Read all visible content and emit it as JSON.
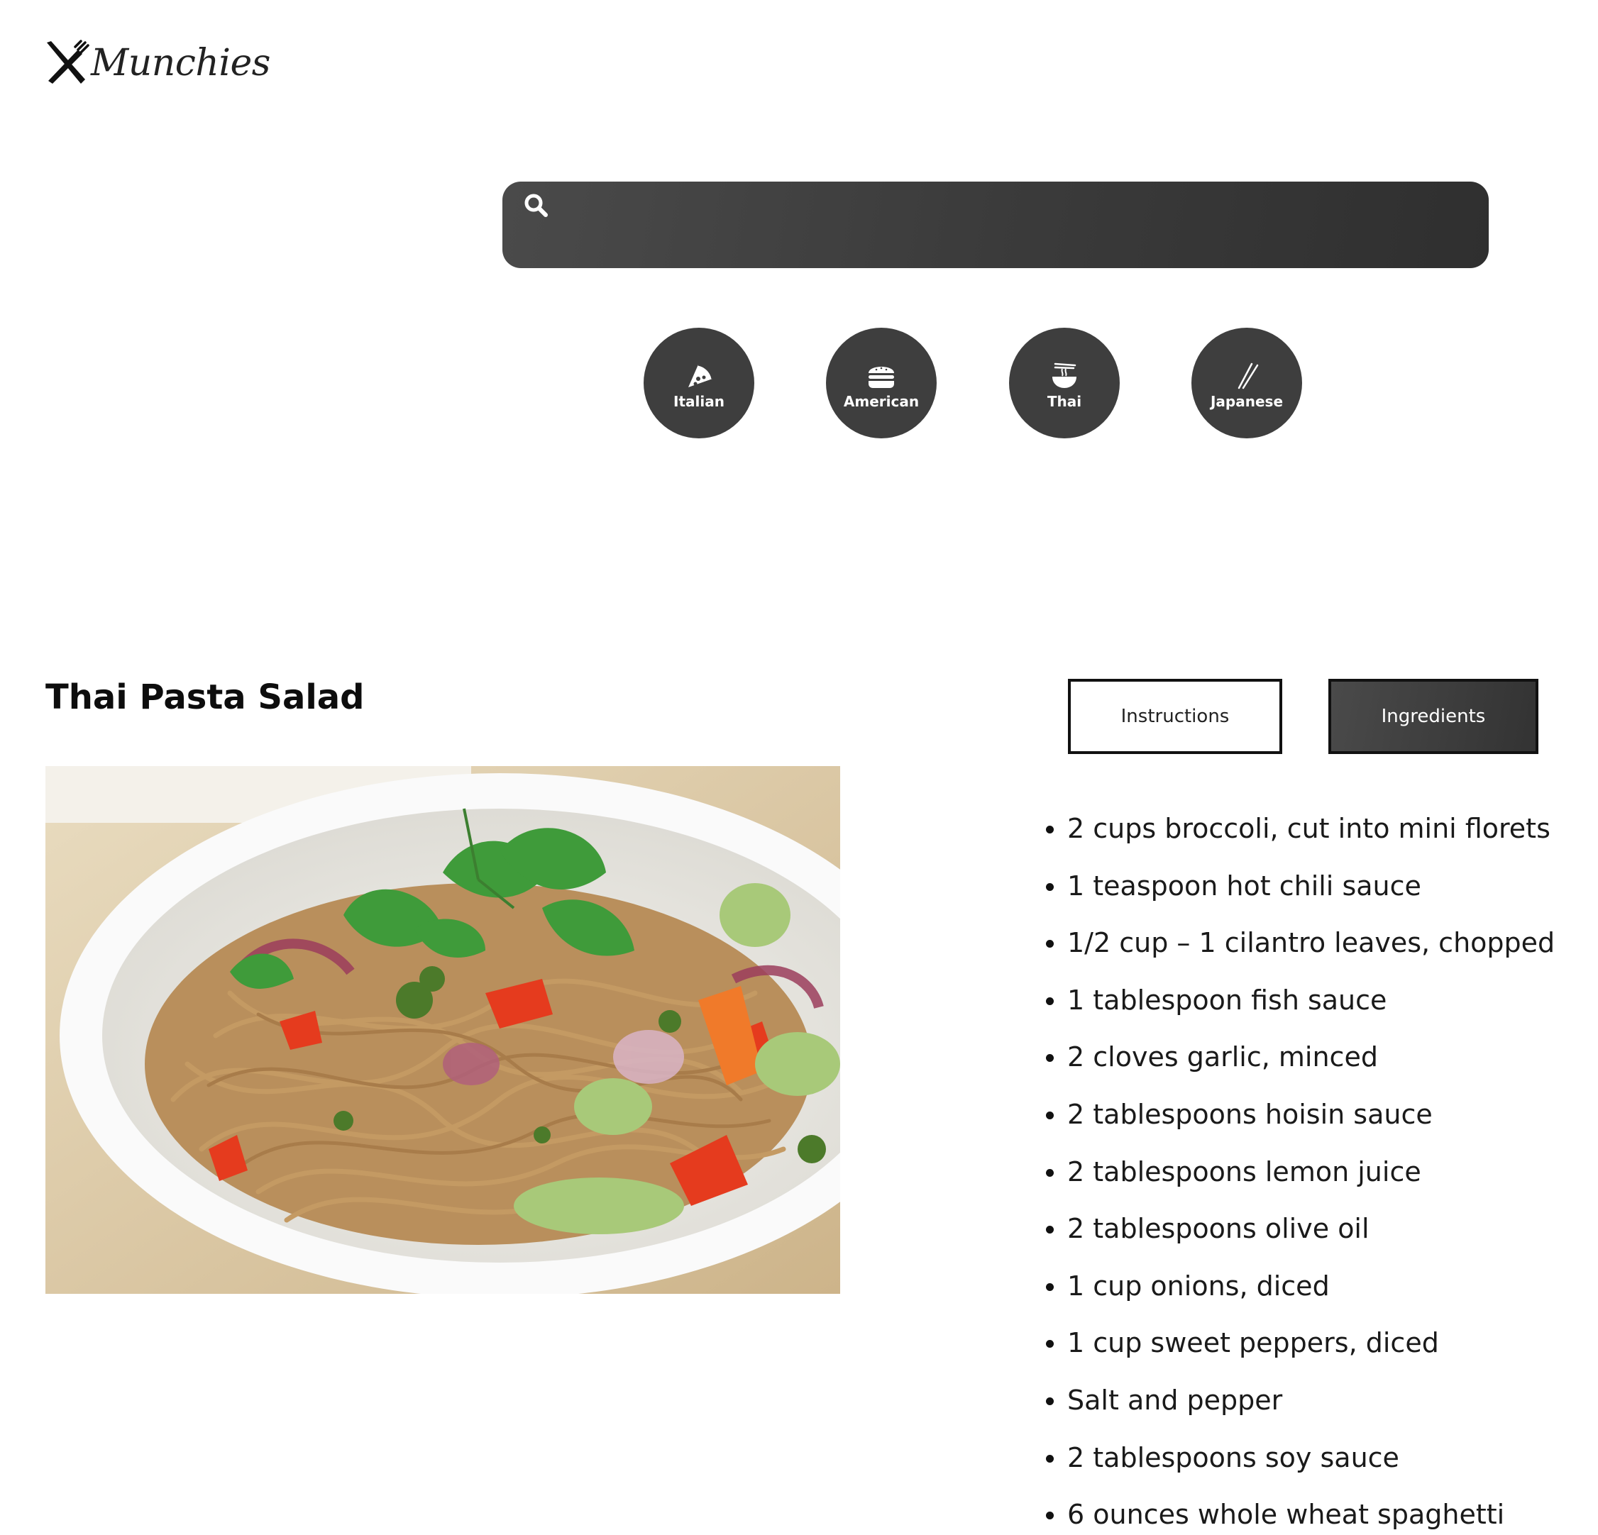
{
  "brand": {
    "name": "Munchies"
  },
  "search": {
    "value": "",
    "placeholder": ""
  },
  "cuisines": [
    {
      "label": "Italian",
      "icon": "pizza-icon"
    },
    {
      "label": "American",
      "icon": "burger-icon"
    },
    {
      "label": "Thai",
      "icon": "noodle-bowl-icon"
    },
    {
      "label": "Japanese",
      "icon": "chopsticks-icon"
    }
  ],
  "recipe": {
    "title": "Thai Pasta Salad",
    "tabs": [
      {
        "label": "Instructions",
        "active": false
      },
      {
        "label": "Ingredients",
        "active": true
      }
    ],
    "ingredients": [
      "2 cups broccoli, cut into mini florets",
      "1 teaspoon hot chili sauce",
      "1/2 cup – 1 cilantro leaves, chopped",
      "1 tablespoon fish sauce",
      "2 cloves garlic, minced",
      "2 tablespoons hoisin sauce",
      "2 tablespoons lemon juice",
      "2 tablespoons olive oil",
      "1 cup onions, diced",
      "1 cup sweet peppers, diced",
      "Salt and pepper",
      "2 tablespoons soy sauce",
      "6 ounces whole wheat spaghetti"
    ]
  },
  "colors": {
    "accent_dark": "#3e3e3e",
    "background": "#ffffff",
    "text": "#111111"
  }
}
